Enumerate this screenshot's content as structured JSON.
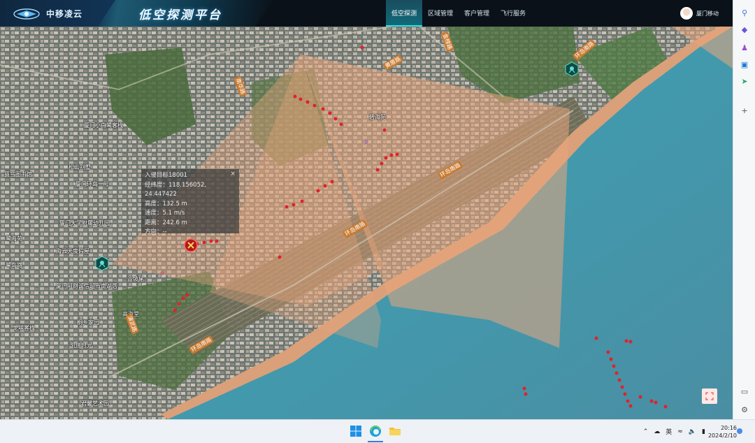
{
  "brand": {
    "name": "中移凌云"
  },
  "app": {
    "title": "低空探测平台"
  },
  "nav": {
    "items": [
      {
        "label": "低空探测",
        "active": true
      },
      {
        "label": "区域管理",
        "active": false
      },
      {
        "label": "客户管理",
        "active": false
      },
      {
        "label": "飞行服务",
        "active": false
      }
    ]
  },
  "user": {
    "name": "厦门移动"
  },
  "target_popup": {
    "title": "入侵目标18001",
    "lines": [
      {
        "label": "经纬度：",
        "value": "118.156052, 24.447422"
      },
      {
        "label": "高度：",
        "value": "132.5 m"
      },
      {
        "label": "速度：",
        "value": "5.1 m/s"
      },
      {
        "label": "距离：",
        "value": "242.6 m"
      },
      {
        "label": "方向：",
        "value": "--"
      }
    ],
    "close": "×"
  },
  "map_labels": {
    "places": [
      "厦门小白鹭客栈",
      "松山别墅",
      "厦门环岛一号",
      "筼筜图书馆",
      "厦门大学附属幼儿园",
      "鹭海苑",
      "海云天度假屋",
      "厦门阿财诚信超市南湖店",
      "鹭岛路",
      "桐乡家园",
      "高海堂",
      "龙萌客栈",
      "凯迪时光",
      "君馨艺术园",
      "环岛南路",
      "环岛南路",
      "环岛南路",
      "环岛南路",
      "碧海苑",
      "沙坡尾",
      "黄厝路",
      "金榜路",
      "南华路",
      "演武路"
    ]
  },
  "colors": {
    "track": "#e0222a",
    "sector": "#e9a57b",
    "accent": "#2fe0d9",
    "sea": "#3f8fa6"
  },
  "taskbar": {
    "ime": "英",
    "time": "20:16",
    "date": "2024/2/10"
  }
}
